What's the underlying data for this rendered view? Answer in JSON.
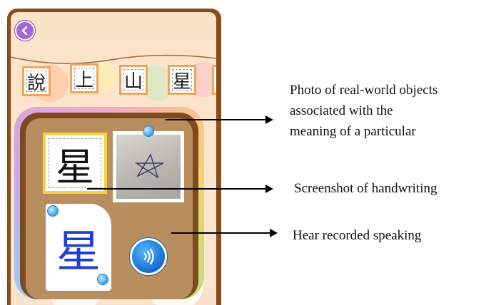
{
  "app": {
    "back_icon": "chevron-left-icon",
    "banner_tiles": [
      "說",
      "上",
      "山",
      "星"
    ],
    "current_character": "星",
    "handwritten_character": "星",
    "speaker_icon": "sound-wave-icon"
  },
  "annotations": {
    "photo_line1": "Photo of real-world objects",
    "photo_line2": "associated with the",
    "photo_line3": "meaning of a particular",
    "handwriting": "Screenshot of handwriting",
    "speaking": "Hear recorded speaking"
  },
  "colors": {
    "frame": "#8a4d1c",
    "tile_border": "#f0a65a",
    "character_card_border": "#f3d43a",
    "handwriting_ink": "#1f3fd1",
    "speaker_button": "#1765c9",
    "back_button": "#a268d9"
  }
}
